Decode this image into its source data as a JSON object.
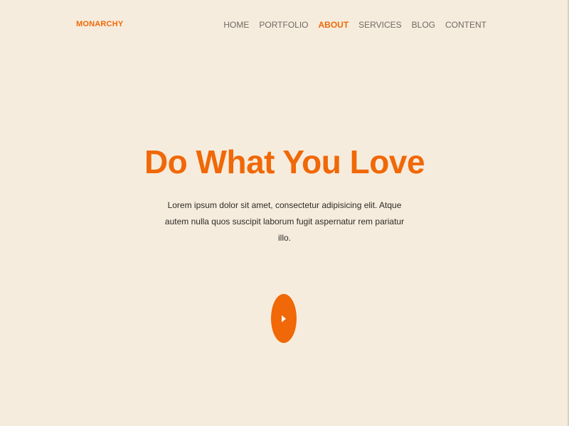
{
  "brand": {
    "logo": "MONARCHY"
  },
  "nav": {
    "items": [
      {
        "label": "HOME"
      },
      {
        "label": "PORTFOLIO"
      },
      {
        "label": "ABOUT",
        "active": true
      },
      {
        "label": "SERVICES"
      },
      {
        "label": "BLOG"
      },
      {
        "label": "CONTENT"
      }
    ]
  },
  "hero": {
    "title": "Do What You Love",
    "description": "Lorem ipsum dolor sit amet, consectetur adipisicing elit. Atque autem nulla quos suscipit laborum fugit aspernatur rem pariatur illo."
  },
  "icons": {
    "play": "play-icon"
  },
  "colors": {
    "accent": "#f06807",
    "background": "#f6ecdd",
    "nav_text": "#6f6a64",
    "body_text": "#2d2a26"
  }
}
